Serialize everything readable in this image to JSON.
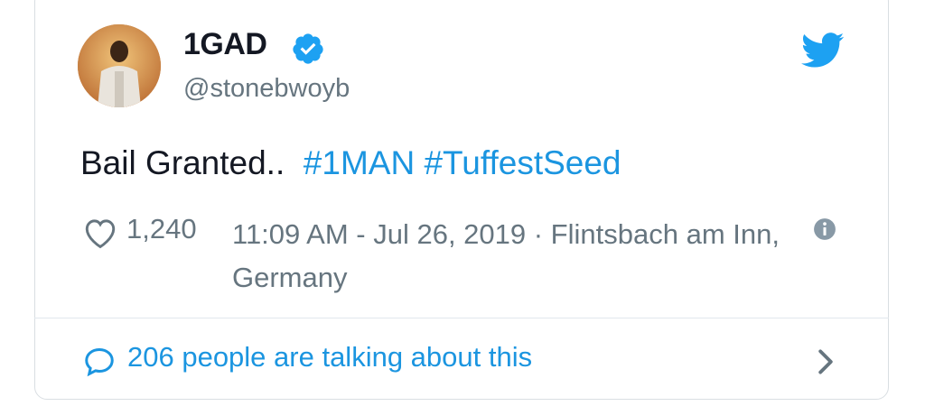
{
  "user": {
    "display_name": "1GAD",
    "handle": "@stonebwoyb"
  },
  "tweet": {
    "text_plain": "Bail Granted..  ",
    "hashtags": [
      "#1MAN",
      "#TuffestSeed"
    ]
  },
  "meta": {
    "likes": "1,240",
    "timestamp_location": "11:09 AM - Jul 26, 2019 · Flintsbach am Inn, Germany"
  },
  "footer": {
    "talking_text": "206 people are talking about this"
  },
  "colors": {
    "accent": "#1b95e0",
    "text": "#141823",
    "muted": "#66757f",
    "border": "#d9dee2"
  },
  "icons": [
    "verified-badge-icon",
    "twitter-bird-icon",
    "heart-icon",
    "info-icon",
    "speech-bubble-icon",
    "chevron-right-icon"
  ]
}
